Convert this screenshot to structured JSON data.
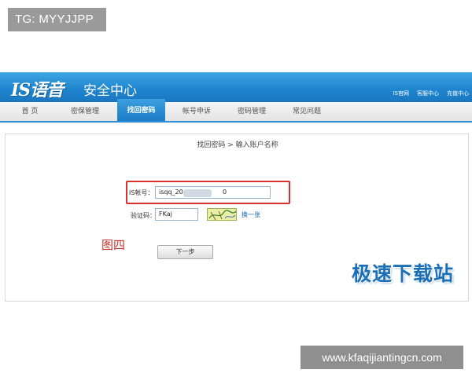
{
  "overlay": {
    "tg_label": "TG: MYYJJPP",
    "site_url": "www.kfaqijiantingcn.com"
  },
  "header": {
    "logo": "IS语音",
    "title": "安全中心",
    "links": [
      "IS官网",
      "客服中心",
      "充值中心"
    ]
  },
  "tabs": [
    {
      "label": "首 页",
      "active": false
    },
    {
      "label": "密保管理",
      "active": false
    },
    {
      "label": "找回密码",
      "active": true
    },
    {
      "label": "帐号申诉",
      "active": false
    },
    {
      "label": "密码管理",
      "active": false
    },
    {
      "label": "常见问题",
      "active": false
    }
  ],
  "breadcrumb": "找回密码 > 输入账户名称",
  "form": {
    "account_label": "IS帐号：",
    "account_value": "isqq_20",
    "account_suffix": "0",
    "captcha_label": "验证码：",
    "captcha_value": "FKaj",
    "refresh_link": "换一张",
    "next_button": "下一步"
  },
  "annotation": "图四",
  "watermark": "极速下载站",
  "colors": {
    "header_blue": "#1f86cf",
    "highlight_red": "#d9322e",
    "link_blue": "#1a64b4"
  }
}
